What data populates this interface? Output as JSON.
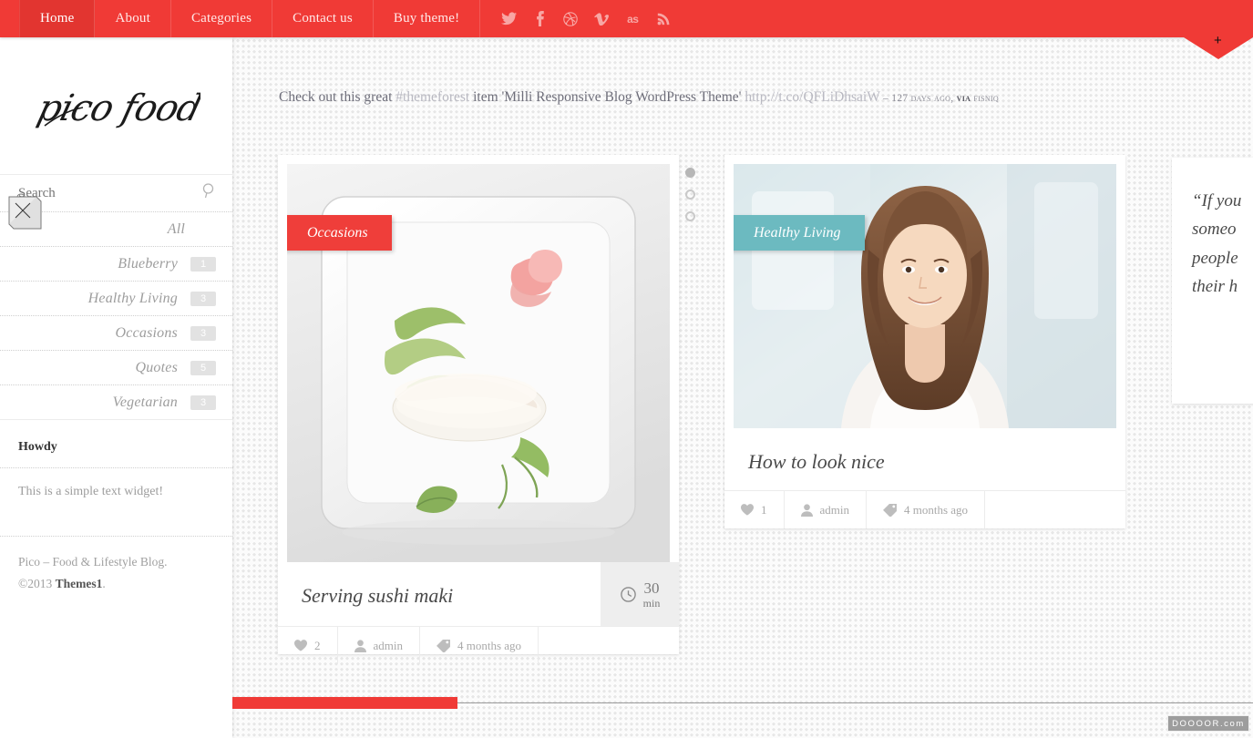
{
  "nav": {
    "items": [
      {
        "label": "Home",
        "active": true
      },
      {
        "label": "About",
        "active": false
      },
      {
        "label": "Categories",
        "active": false
      },
      {
        "label": "Contact us",
        "active": false
      },
      {
        "label": "Buy theme!",
        "active": false
      }
    ],
    "socials": [
      {
        "name": "twitter-icon"
      },
      {
        "name": "facebook-icon"
      },
      {
        "name": "dribbble-icon"
      },
      {
        "name": "vimeo-icon"
      },
      {
        "name": "lastfm-icon",
        "label": "as"
      },
      {
        "name": "rss-icon"
      }
    ],
    "bg_color": "#f03a36",
    "active_bg_color": "#e23530"
  },
  "sidebar": {
    "logo_text": "pico food.",
    "search": {
      "value": "",
      "placeholder": "Search",
      "icon": "search-icon"
    },
    "categories": [
      {
        "label": "All",
        "count": ""
      },
      {
        "label": "Blueberry",
        "count": "1"
      },
      {
        "label": "Healthy Living",
        "count": "3"
      },
      {
        "label": "Occasions",
        "count": "3"
      },
      {
        "label": "Quotes",
        "count": "5"
      },
      {
        "label": "Vegetarian",
        "count": "3"
      }
    ],
    "widget": {
      "title": "Howdy",
      "text": "This is a simple text widget!"
    },
    "footer": {
      "line1": "Pico – Food & Lifestyle Blog.",
      "copyright": "©2013 ",
      "brand": "Themes1",
      "period": "."
    }
  },
  "tweet": {
    "part1": "Check out this great ",
    "hashtag": "#themeforest",
    "part2": " item 'Milli Responsive Blog WordPress Theme' ",
    "link": "http://t.co/QFLiDhsaiW",
    "dash": " – ",
    "age": "127 days ago, ",
    "via_label": "via",
    "via_source": " fisniq"
  },
  "posts": [
    {
      "category": "Occasions",
      "category_color": "#ef3e3a",
      "title": "Serving sushi maki",
      "time_value": "30",
      "time_unit": "min",
      "likes": "2",
      "author": "admin",
      "date": "4 months ago",
      "image_alt": "white square plate with sushi maki, cucumber and ginger"
    },
    {
      "category": "Healthy Living",
      "category_color": "#6cbac0",
      "title": "How to look nice",
      "likes": "1",
      "author": "admin",
      "date": "4 months ago",
      "image_alt": "smiling woman with long brown hair"
    }
  ],
  "quote_card": {
    "lines": [
      "“If you",
      "someo",
      "people",
      "their h"
    ]
  },
  "pager": {
    "dots": [
      true,
      false,
      false
    ]
  },
  "loading": {
    "progress_percent": 22,
    "bar_color": "#f03a36"
  },
  "watermark": {
    "text": "DOOOOR.com"
  }
}
